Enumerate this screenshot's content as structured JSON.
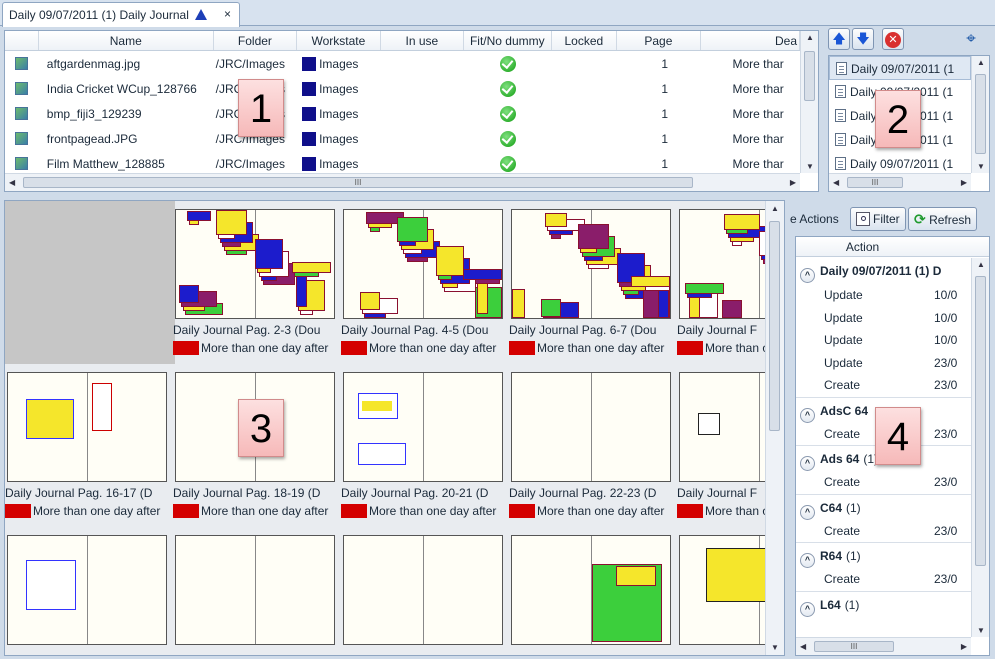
{
  "tab": {
    "title": "Daily 09/07/2011 (1) Daily Journal",
    "close": "×"
  },
  "files": {
    "columns": [
      "Name",
      "Folder",
      "Workstate",
      "In use",
      "Fit/No dummy",
      "Locked",
      "Page",
      "Dea"
    ],
    "rows": [
      {
        "name": "aftgardenmag.jpg",
        "folder": "/JRC/Images",
        "workstate": "Images",
        "page": "1",
        "deadline": "More thar"
      },
      {
        "name": "India Cricket WCup_128766",
        "folder": "/JRC/Images",
        "workstate": "Images",
        "page": "1",
        "deadline": "More thar"
      },
      {
        "name": "bmp_fiji3_129239",
        "folder": "/JRC/Images",
        "workstate": "Images",
        "page": "1",
        "deadline": "More thar"
      },
      {
        "name": "frontpagead.JPG",
        "folder": "/JRC/Images",
        "workstate": "Images",
        "page": "1",
        "deadline": "More thar"
      },
      {
        "name": "Film Matthew_128885",
        "folder": "/JRC/Images",
        "workstate": "Images",
        "page": "1",
        "deadline": "More thar"
      }
    ]
  },
  "editions": {
    "items": [
      "Daily 09/07/2011 (1",
      "Daily 09/07/2011 (1",
      "Daily 09/07/2011 (1",
      "Daily 09/07/2011 (1",
      "Daily 09/07/2011 (1"
    ]
  },
  "pages": {
    "status_text": "More than one day after",
    "rows": [
      [
        "",
        "Daily Journal Pag. 2-3  (Dou",
        "Daily Journal Pag. 4-5  (Dou",
        "Daily Journal Pag. 6-7  (Dou",
        "Daily Journal F"
      ],
      [
        "Daily Journal Pag. 16-17  (D",
        "Daily Journal Pag. 18-19  (D",
        "Daily Journal Pag. 20-21  (D",
        "Daily Journal Pag. 22-23  (D",
        "Daily Journal F"
      ]
    ]
  },
  "actions_panel": {
    "title_fragment": "e Actions",
    "filter_label": "Filter",
    "refresh_label": "Refresh",
    "column": "Action",
    "groups": [
      {
        "name": "Daily 09/07/2011 (1) D",
        "count": "",
        "items": [
          {
            "action": "Update",
            "date": "10/0"
          },
          {
            "action": "Update",
            "date": "10/0"
          },
          {
            "action": "Update",
            "date": "10/0"
          },
          {
            "action": "Update",
            "date": "23/0"
          },
          {
            "action": "Create",
            "date": "23/0"
          }
        ]
      },
      {
        "name": "AdsC 64",
        "count": "",
        "items": [
          {
            "action": "Create",
            "date": "23/0"
          }
        ]
      },
      {
        "name": "Ads 64",
        "count": "(1)",
        "items": [
          {
            "action": "Create",
            "date": "23/0"
          }
        ]
      },
      {
        "name": "C64",
        "count": "(1)",
        "items": [
          {
            "action": "Create",
            "date": "23/0"
          }
        ]
      },
      {
        "name": "R64",
        "count": "(1)",
        "items": [
          {
            "action": "Create",
            "date": "23/0"
          }
        ]
      },
      {
        "name": "L64",
        "count": "(1)",
        "items": []
      }
    ]
  },
  "callouts": [
    "1",
    "2",
    "3",
    "4"
  ],
  "icons": {
    "file": "image-file-icon",
    "check": "check-circle-icon",
    "doc": "document-icon",
    "up": "arrow-up-icon",
    "down": "arrow-down-icon",
    "delete": "delete-icon",
    "binoculars": "binoculars-icon",
    "filter": "filter-icon",
    "refresh": "refresh-icon"
  },
  "colors": {
    "workstate": "#0f0f8a",
    "status_red": "#d40000",
    "check_green": "#129e12",
    "accent": "#1d3fb7"
  },
  "scroll_marker": "III"
}
